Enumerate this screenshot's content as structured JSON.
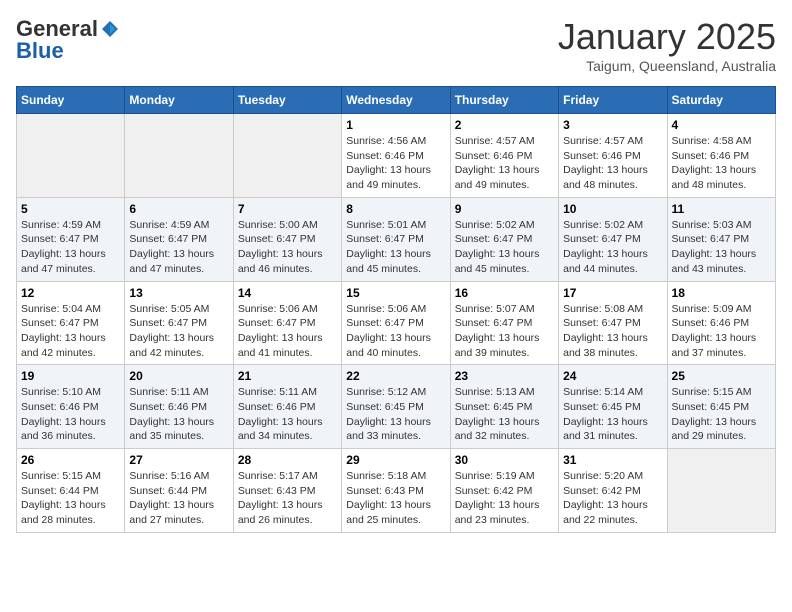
{
  "logo": {
    "general": "General",
    "blue": "Blue"
  },
  "header": {
    "month": "January 2025",
    "location": "Taigum, Queensland, Australia"
  },
  "days_of_week": [
    "Sunday",
    "Monday",
    "Tuesday",
    "Wednesday",
    "Thursday",
    "Friday",
    "Saturday"
  ],
  "weeks": [
    [
      {
        "day": "",
        "info": ""
      },
      {
        "day": "",
        "info": ""
      },
      {
        "day": "",
        "info": ""
      },
      {
        "day": "1",
        "info": "Sunrise: 4:56 AM\nSunset: 6:46 PM\nDaylight: 13 hours\nand 49 minutes."
      },
      {
        "day": "2",
        "info": "Sunrise: 4:57 AM\nSunset: 6:46 PM\nDaylight: 13 hours\nand 49 minutes."
      },
      {
        "day": "3",
        "info": "Sunrise: 4:57 AM\nSunset: 6:46 PM\nDaylight: 13 hours\nand 48 minutes."
      },
      {
        "day": "4",
        "info": "Sunrise: 4:58 AM\nSunset: 6:46 PM\nDaylight: 13 hours\nand 48 minutes."
      }
    ],
    [
      {
        "day": "5",
        "info": "Sunrise: 4:59 AM\nSunset: 6:47 PM\nDaylight: 13 hours\nand 47 minutes."
      },
      {
        "day": "6",
        "info": "Sunrise: 4:59 AM\nSunset: 6:47 PM\nDaylight: 13 hours\nand 47 minutes."
      },
      {
        "day": "7",
        "info": "Sunrise: 5:00 AM\nSunset: 6:47 PM\nDaylight: 13 hours\nand 46 minutes."
      },
      {
        "day": "8",
        "info": "Sunrise: 5:01 AM\nSunset: 6:47 PM\nDaylight: 13 hours\nand 45 minutes."
      },
      {
        "day": "9",
        "info": "Sunrise: 5:02 AM\nSunset: 6:47 PM\nDaylight: 13 hours\nand 45 minutes."
      },
      {
        "day": "10",
        "info": "Sunrise: 5:02 AM\nSunset: 6:47 PM\nDaylight: 13 hours\nand 44 minutes."
      },
      {
        "day": "11",
        "info": "Sunrise: 5:03 AM\nSunset: 6:47 PM\nDaylight: 13 hours\nand 43 minutes."
      }
    ],
    [
      {
        "day": "12",
        "info": "Sunrise: 5:04 AM\nSunset: 6:47 PM\nDaylight: 13 hours\nand 42 minutes."
      },
      {
        "day": "13",
        "info": "Sunrise: 5:05 AM\nSunset: 6:47 PM\nDaylight: 13 hours\nand 42 minutes."
      },
      {
        "day": "14",
        "info": "Sunrise: 5:06 AM\nSunset: 6:47 PM\nDaylight: 13 hours\nand 41 minutes."
      },
      {
        "day": "15",
        "info": "Sunrise: 5:06 AM\nSunset: 6:47 PM\nDaylight: 13 hours\nand 40 minutes."
      },
      {
        "day": "16",
        "info": "Sunrise: 5:07 AM\nSunset: 6:47 PM\nDaylight: 13 hours\nand 39 minutes."
      },
      {
        "day": "17",
        "info": "Sunrise: 5:08 AM\nSunset: 6:47 PM\nDaylight: 13 hours\nand 38 minutes."
      },
      {
        "day": "18",
        "info": "Sunrise: 5:09 AM\nSunset: 6:46 PM\nDaylight: 13 hours\nand 37 minutes."
      }
    ],
    [
      {
        "day": "19",
        "info": "Sunrise: 5:10 AM\nSunset: 6:46 PM\nDaylight: 13 hours\nand 36 minutes."
      },
      {
        "day": "20",
        "info": "Sunrise: 5:11 AM\nSunset: 6:46 PM\nDaylight: 13 hours\nand 35 minutes."
      },
      {
        "day": "21",
        "info": "Sunrise: 5:11 AM\nSunset: 6:46 PM\nDaylight: 13 hours\nand 34 minutes."
      },
      {
        "day": "22",
        "info": "Sunrise: 5:12 AM\nSunset: 6:45 PM\nDaylight: 13 hours\nand 33 minutes."
      },
      {
        "day": "23",
        "info": "Sunrise: 5:13 AM\nSunset: 6:45 PM\nDaylight: 13 hours\nand 32 minutes."
      },
      {
        "day": "24",
        "info": "Sunrise: 5:14 AM\nSunset: 6:45 PM\nDaylight: 13 hours\nand 31 minutes."
      },
      {
        "day": "25",
        "info": "Sunrise: 5:15 AM\nSunset: 6:45 PM\nDaylight: 13 hours\nand 29 minutes."
      }
    ],
    [
      {
        "day": "26",
        "info": "Sunrise: 5:15 AM\nSunset: 6:44 PM\nDaylight: 13 hours\nand 28 minutes."
      },
      {
        "day": "27",
        "info": "Sunrise: 5:16 AM\nSunset: 6:44 PM\nDaylight: 13 hours\nand 27 minutes."
      },
      {
        "day": "28",
        "info": "Sunrise: 5:17 AM\nSunset: 6:43 PM\nDaylight: 13 hours\nand 26 minutes."
      },
      {
        "day": "29",
        "info": "Sunrise: 5:18 AM\nSunset: 6:43 PM\nDaylight: 13 hours\nand 25 minutes."
      },
      {
        "day": "30",
        "info": "Sunrise: 5:19 AM\nSunset: 6:42 PM\nDaylight: 13 hours\nand 23 minutes."
      },
      {
        "day": "31",
        "info": "Sunrise: 5:20 AM\nSunset: 6:42 PM\nDaylight: 13 hours\nand 22 minutes."
      },
      {
        "day": "",
        "info": ""
      }
    ]
  ]
}
